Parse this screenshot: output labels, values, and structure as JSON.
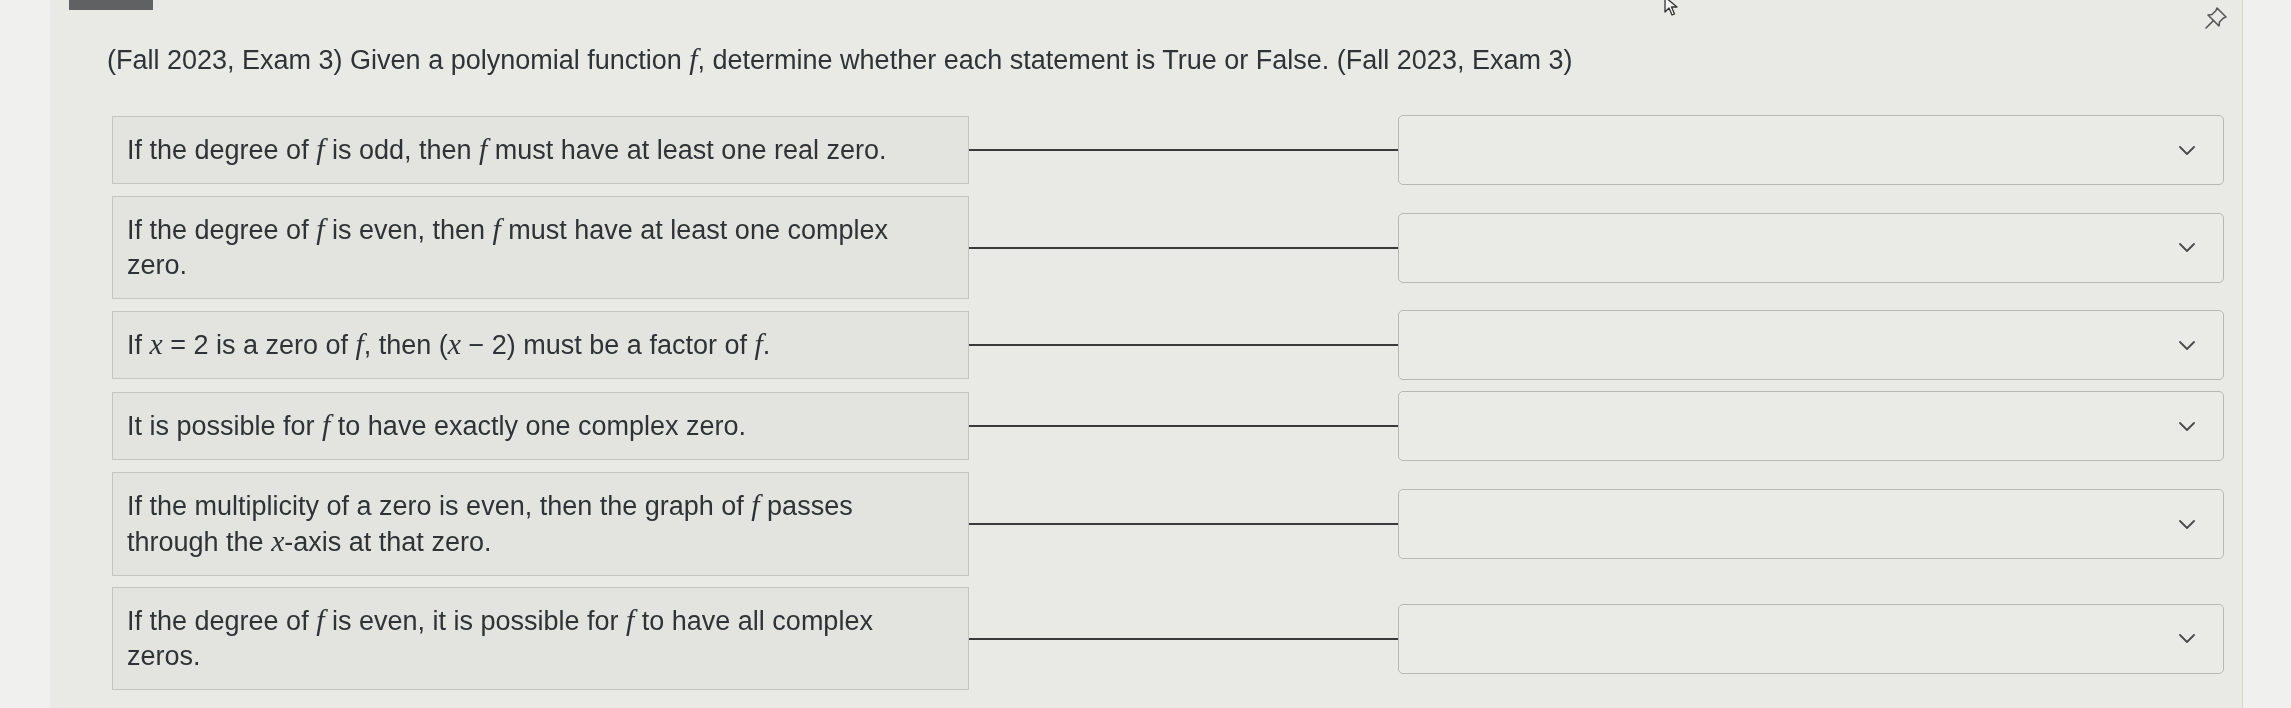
{
  "question": {
    "text": "(Fall 2023, Exam 3) Given a polynomial function *f*, determine whether each statement is True or False. (Fall 2023, Exam 3)"
  },
  "statements": [
    {
      "text": "If the degree of *f* is odd, then *f* must have at least one real zero."
    },
    {
      "text": "If the degree of *f* is even, then *f* must have at least one complex zero."
    },
    {
      "text": "If *x* = 2 is a zero of *f*, then (*x* − 2) must be a factor of *f*."
    },
    {
      "text": "It is possible for *f* to have exactly one complex zero."
    },
    {
      "text": "If the multiplicity of a zero is even, then the graph of *f* passes through the *x*-axis at that zero."
    },
    {
      "text": "If the degree of *f* is even, it is possible for *f* to have all complex zeros."
    }
  ]
}
